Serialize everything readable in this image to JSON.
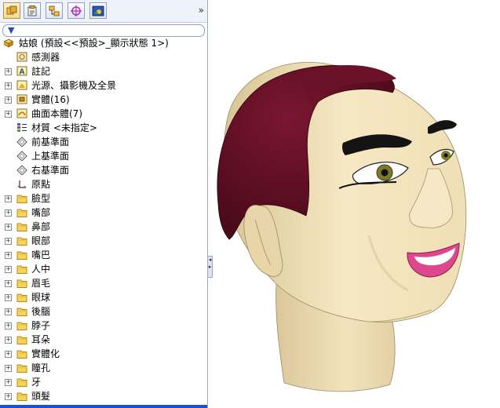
{
  "toolbar": {
    "tabs": [
      {
        "name": "feature-manager-tab",
        "icon": "feature-tree-icon",
        "active": true
      },
      {
        "name": "property-manager-tab",
        "icon": "property-icon"
      },
      {
        "name": "configuration-manager-tab",
        "icon": "configuration-icon"
      },
      {
        "name": "dim-xpert-tab",
        "icon": "crosshair-icon"
      },
      {
        "name": "display-manager-tab",
        "icon": "display-icon"
      }
    ],
    "more": "»"
  },
  "filter": {
    "icon": "filter-icon",
    "glyph": "▼"
  },
  "tree": {
    "root": {
      "label": "姑娘  (預設<<預設>_顯示狀態 1>)",
      "icon": "part-icon"
    },
    "items": [
      {
        "label": "感測器",
        "icon": "sensor-icon",
        "expandable": false
      },
      {
        "label": "註記",
        "icon": "annotation-icon",
        "expandable": true
      },
      {
        "label": "光源、攝影機及全景",
        "icon": "lights-icon",
        "expandable": true
      },
      {
        "label": "實體(16)",
        "icon": "solid-bodies-icon",
        "expandable": true
      },
      {
        "label": "曲面本體(7)",
        "icon": "surface-bodies-icon",
        "expandable": true
      },
      {
        "label": "材質 <未指定>",
        "icon": "material-icon",
        "expandable": false
      },
      {
        "label": "前基準面",
        "icon": "plane-icon",
        "expandable": false
      },
      {
        "label": "上基準面",
        "icon": "plane-icon",
        "expandable": false
      },
      {
        "label": "右基準面",
        "icon": "plane-icon",
        "expandable": false
      },
      {
        "label": "原點",
        "icon": "origin-icon",
        "expandable": false
      },
      {
        "label": "臉型",
        "icon": "folder-icon",
        "expandable": true
      },
      {
        "label": "嘴部",
        "icon": "folder-icon",
        "expandable": true
      },
      {
        "label": "鼻部",
        "icon": "folder-icon",
        "expandable": true
      },
      {
        "label": "眼部",
        "icon": "folder-icon",
        "expandable": true
      },
      {
        "label": "嘴巴",
        "icon": "folder-icon",
        "expandable": true
      },
      {
        "label": "人中",
        "icon": "folder-icon",
        "expandable": true
      },
      {
        "label": "眉毛",
        "icon": "folder-icon",
        "expandable": true
      },
      {
        "label": "眼球",
        "icon": "folder-icon",
        "expandable": true
      },
      {
        "label": "後腦",
        "icon": "folder-icon",
        "expandable": true
      },
      {
        "label": "脖子",
        "icon": "folder-icon",
        "expandable": true
      },
      {
        "label": "耳朵",
        "icon": "folder-icon",
        "expandable": true
      },
      {
        "label": "實體化",
        "icon": "folder-icon",
        "expandable": true
      },
      {
        "label": "瞳孔",
        "icon": "folder-icon",
        "expandable": true
      },
      {
        "label": "牙",
        "icon": "folder-icon",
        "expandable": true
      },
      {
        "label": "頭髮",
        "icon": "folder-icon",
        "expandable": true
      }
    ]
  },
  "colors": {
    "skin": "#f3e4bf",
    "hair": "#5a0e22",
    "eyebrow": "#141414",
    "lips": "#e0468d",
    "iris": "#7b7a2a"
  }
}
